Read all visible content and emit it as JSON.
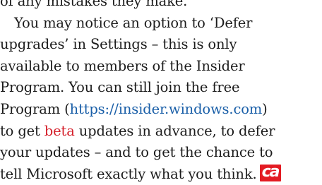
{
  "article": {
    "top_line": "of any mistakes they make.",
    "lines": [
      "You may notice an option to ‘Defer",
      "upgrades’ in Settings – this is only",
      "available to members of the Insider",
      "Program. You can still join the free"
    ],
    "line5_before": "Program (",
    "url": "https://insider.windows.com",
    "line5_after": ")",
    "line6_before": "to get ",
    "beta": "beta",
    "line6_after": " updates in advance, to defer",
    "line7": "your updates – and to get the chance to",
    "line8": "tell Microsoft exactly what you think.",
    "logo": "ca"
  },
  "colors": {
    "text": "#1c1c1c",
    "link_blue": "#1a5fa8",
    "link_red": "#d5202b",
    "logo_bg": "#e31b23"
  }
}
